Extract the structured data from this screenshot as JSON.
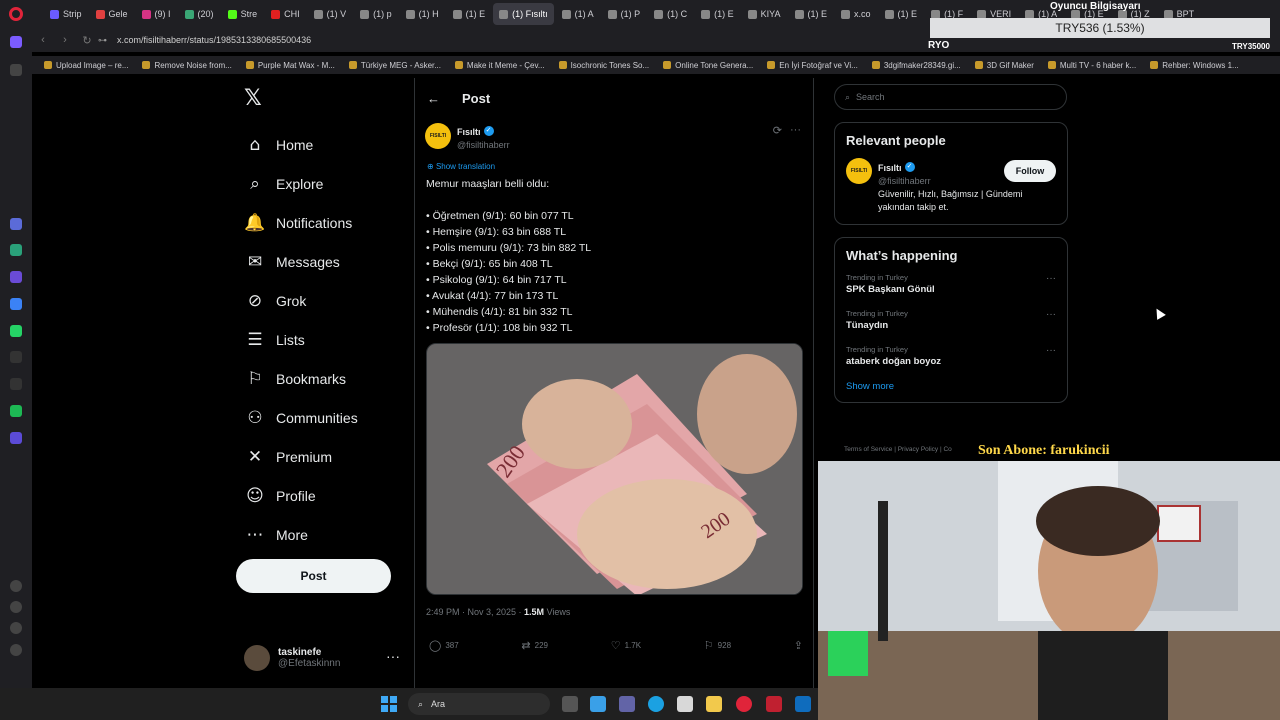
{
  "browser": {
    "tabs": [
      {
        "label": "Strip",
        "color": "#6b5bff"
      },
      {
        "label": "Gele",
        "color": "#e04040"
      },
      {
        "label": "(9) I",
        "color": "#d63384"
      },
      {
        "label": "(20)",
        "color": "#3aa675"
      },
      {
        "label": "Stre",
        "color": "#53fc18"
      },
      {
        "label": "CHI",
        "color": "#e02020"
      },
      {
        "label": "(1) V",
        "color": "#888888"
      },
      {
        "label": "(1) p",
        "color": "#888888"
      },
      {
        "label": "(1) H",
        "color": "#888888"
      },
      {
        "label": "(1) E",
        "color": "#888888"
      },
      {
        "label": "(1) Fısıltı",
        "color": "#888888",
        "active": true
      },
      {
        "label": "(1) A",
        "color": "#888888"
      },
      {
        "label": "(1) P",
        "color": "#888888"
      },
      {
        "label": "(1) C",
        "color": "#888888"
      },
      {
        "label": "(1) E",
        "color": "#888888"
      },
      {
        "label": "KIYA",
        "color": "#888888"
      },
      {
        "label": "(1) E",
        "color": "#888888"
      },
      {
        "label": "x.co",
        "color": "#888888"
      },
      {
        "label": "(1) E",
        "color": "#888888"
      },
      {
        "label": "(1) F",
        "color": "#888888"
      },
      {
        "label": "VERI",
        "color": "#888888"
      },
      {
        "label": "(1) A",
        "color": "#888888"
      },
      {
        "label": "(1) E",
        "color": "#888888"
      },
      {
        "label": "(1) Z",
        "color": "#888888"
      },
      {
        "label": "BPT",
        "color": "#888888"
      }
    ],
    "url": "x.com/fisiltihaberr/status/1985313380685500436",
    "bookmarks": [
      "Upload Image – re...",
      "Remove Noise from...",
      "Purple Mat Wax - M...",
      "Türkiye MEG - Asker...",
      "Make it Meme - Çev...",
      "Isochronic Tones So...",
      "Online Tone Genera...",
      "En İyi Fotoğraf ve Vi...",
      "3dgifmaker28349.gi...",
      "3D Gif Maker",
      "Multi TV - 6 haber k...",
      "Rehber: Windows 1..."
    ]
  },
  "nav": {
    "items": [
      {
        "label": "Home",
        "icon": "home-icon",
        "glyph": "⌂"
      },
      {
        "label": "Explore",
        "icon": "search-icon",
        "glyph": "⌕"
      },
      {
        "label": "Notifications",
        "icon": "bell-icon",
        "glyph": "🔔"
      },
      {
        "label": "Messages",
        "icon": "envelope-icon",
        "glyph": "✉"
      },
      {
        "label": "Grok",
        "icon": "grok-icon",
        "glyph": "⊘"
      },
      {
        "label": "Lists",
        "icon": "list-icon",
        "glyph": "☰"
      },
      {
        "label": "Bookmarks",
        "icon": "bookmark-icon",
        "glyph": "⚐"
      },
      {
        "label": "Communities",
        "icon": "people-icon",
        "glyph": "⚇"
      },
      {
        "label": "Premium",
        "icon": "x-icon",
        "glyph": "✕"
      },
      {
        "label": "Profile",
        "icon": "person-icon",
        "glyph": "☺"
      },
      {
        "label": "More",
        "icon": "more-circle-icon",
        "glyph": "⋯"
      }
    ],
    "post_button": "Post",
    "account": {
      "name": "taskinefe",
      "handle": "@Efetaskinnn"
    }
  },
  "main": {
    "header": "Post",
    "author": {
      "name": "Fısıltı",
      "handle": "@fisiltihaberr",
      "logo_text": "FISILTI"
    },
    "show_translation": "Show translation",
    "text": "Memur maaşları belli oldu:\n\n• Öğretmen (9/1): 60 bin 077 TL\n• Hemşire (9/1): 63 bin 688 TL\n• Polis memuru (9/1): 73 bin 882 TL\n• Bekçi (9/1): 65 bin 408 TL\n• Psikolog (9/1): 64 bin 717 TL\n• Avukat (4/1): 77 bin 173 TL\n• Mühendis (4/1): 81 bin 332 TL\n• Profesör (1/1): 108 bin 932 TL",
    "timestamp": "2:49 PM · Nov 3, 2025 · ",
    "views_count": "1.5M",
    "views_label": " Views",
    "actions": {
      "replies": "387",
      "reposts": "229",
      "likes": "1.7K",
      "bookmarks": "928"
    },
    "image_banknote_text": "200"
  },
  "right": {
    "search_placeholder": "Search",
    "relevant_title": "Relevant people",
    "relevant": {
      "name": "Fısıltı",
      "handle": "@fisiltihaberr",
      "bio": "Güvenilir, Hızlı, Bağımsız | Gündemi yakından takip et.",
      "follow": "Follow"
    },
    "happening_title": "What’s happening",
    "trends": [
      {
        "sub": "Trending in Turkey",
        "name": "SPK Başkanı Gönül"
      },
      {
        "sub": "Trending in Turkey",
        "name": "Tünaydın"
      },
      {
        "sub": "Trending in Turkey",
        "name": "ataberk doğan boyoz"
      }
    ],
    "show_more": "Show more",
    "footer": "Terms of Service  |  Privacy Policy  |  Co"
  },
  "overlays": {
    "price": "TRY536 (1.53%)",
    "stream_title": "Oyuncu Bilgisayarı",
    "left_ticker": "RYO",
    "right_ticker": "TRY35000",
    "last_sub": "Son Abone: farukincii"
  },
  "taskbar": {
    "search": "Ara"
  },
  "colors": {
    "accent": "#1d9bf0",
    "bg": "#000000",
    "border": "#2f3336",
    "muted": "#71767b"
  }
}
